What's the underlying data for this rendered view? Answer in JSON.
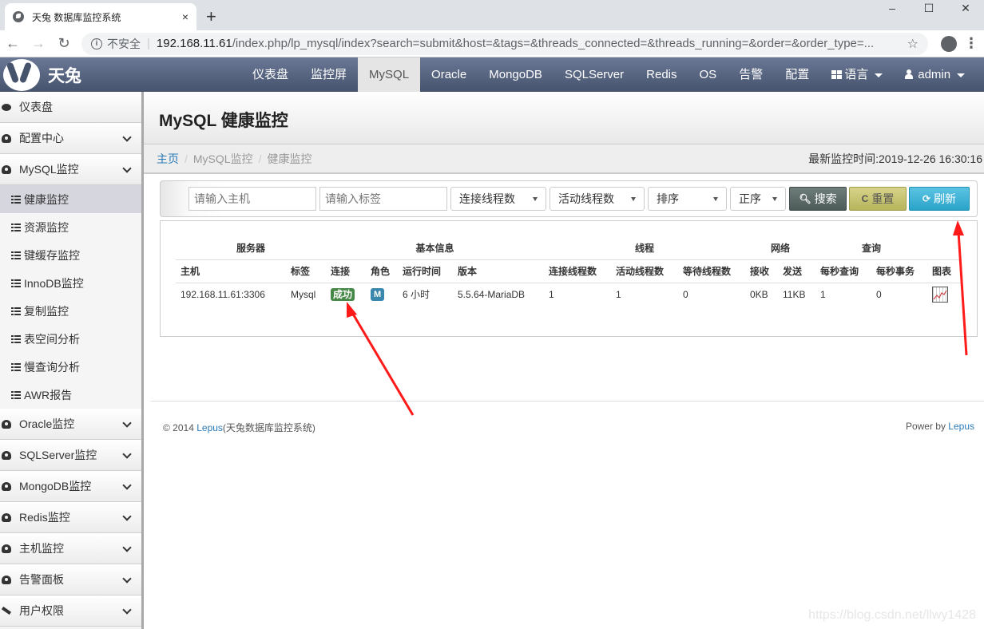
{
  "browser": {
    "tab_title": "天兔 数据库监控系统",
    "close_tab": "×",
    "new_tab": "+",
    "window_controls": [
      "–",
      "☐",
      "✕"
    ],
    "insecure_label": "不安全",
    "url_host": "192.168.11.61",
    "url_path": "/index.php/lp_mysql/index?search=submit&host=&tags=&threads_connected=&threads_running=&order=&order_type=..."
  },
  "navbar": {
    "brand": "天兔",
    "links": [
      "仪表盘",
      "监控屏",
      "MySQL",
      "Oracle",
      "MongoDB",
      "SQLServer",
      "Redis",
      "OS",
      "告警",
      "配置"
    ],
    "active": "MySQL",
    "language": "语言",
    "user": "admin"
  },
  "sidebar": {
    "top": [
      {
        "label": "仪表盘",
        "icon": "comment-icon"
      },
      {
        "label": "配置中心",
        "icon": "dashboard-icon"
      },
      {
        "label": "MySQL监控",
        "icon": "dashboard-icon"
      }
    ],
    "sub": [
      "健康监控",
      "资源监控",
      "键缓存监控",
      "InnoDB监控",
      "复制监控",
      "表空间分析",
      "慢查询分析",
      "AWR报告"
    ],
    "active_sub": "健康监控",
    "bottom": [
      {
        "label": "Oracle监控",
        "icon": "dashboard-icon"
      },
      {
        "label": "SQLServer监控",
        "icon": "dashboard-icon"
      },
      {
        "label": "MongoDB监控",
        "icon": "dashboard-icon"
      },
      {
        "label": "Redis监控",
        "icon": "dashboard-icon"
      },
      {
        "label": "主机监控",
        "icon": "dashboard-icon"
      },
      {
        "label": "告警面板",
        "icon": "dashboard-icon"
      },
      {
        "label": "用户权限",
        "icon": "hammer-icon"
      }
    ]
  },
  "page": {
    "title": "MySQL 健康监控",
    "breadcrumb": [
      "主页",
      "MySQL监控",
      "健康监控"
    ],
    "last_monitor_time": "最新监控时间:2019-12-26 16:30:16"
  },
  "filters": {
    "host_placeholder": "请输入主机",
    "tags_placeholder": "请输入标签",
    "threads_connected": "连接线程数",
    "threads_running": "活动线程数",
    "order": "排序",
    "order_type": "正序",
    "search": "搜索",
    "reset": "重置",
    "refresh": "刷新"
  },
  "table": {
    "groups": [
      "服务器",
      "基本信息",
      "线程",
      "网络",
      "查询"
    ],
    "columns": [
      "主机",
      "标签",
      "连接",
      "角色",
      "运行时间",
      "版本",
      "连接线程数",
      "活动线程数",
      "等待线程数",
      "接收",
      "发送",
      "每秒查询",
      "每秒事务",
      "图表"
    ],
    "rows": [
      {
        "host": "192.168.11.61:3306",
        "tags": "Mysql",
        "connect": "成功",
        "role": "M",
        "uptime": "6 小时",
        "version": "5.5.64-MariaDB",
        "threads_connected": "1",
        "threads_running": "1",
        "threads_waits": "0",
        "bytes_received": "0KB",
        "bytes_sent": "11KB",
        "qps": "1",
        "tps": "0"
      }
    ]
  },
  "footer": {
    "copyright": "© 2014 ",
    "lepus_link": "Lepus",
    "system_name": "(天兔数据库监控系统)",
    "power_by": "Power by ",
    "power_link": "Lepus"
  },
  "watermark": "https://blog.csdn.net/llwy1428",
  "colors": {
    "navbar": "#55627c",
    "success": "#468847",
    "role_master": "#3a87ad",
    "link": "#2a7ab8",
    "annotation_arrow": "#ff1a1a"
  }
}
